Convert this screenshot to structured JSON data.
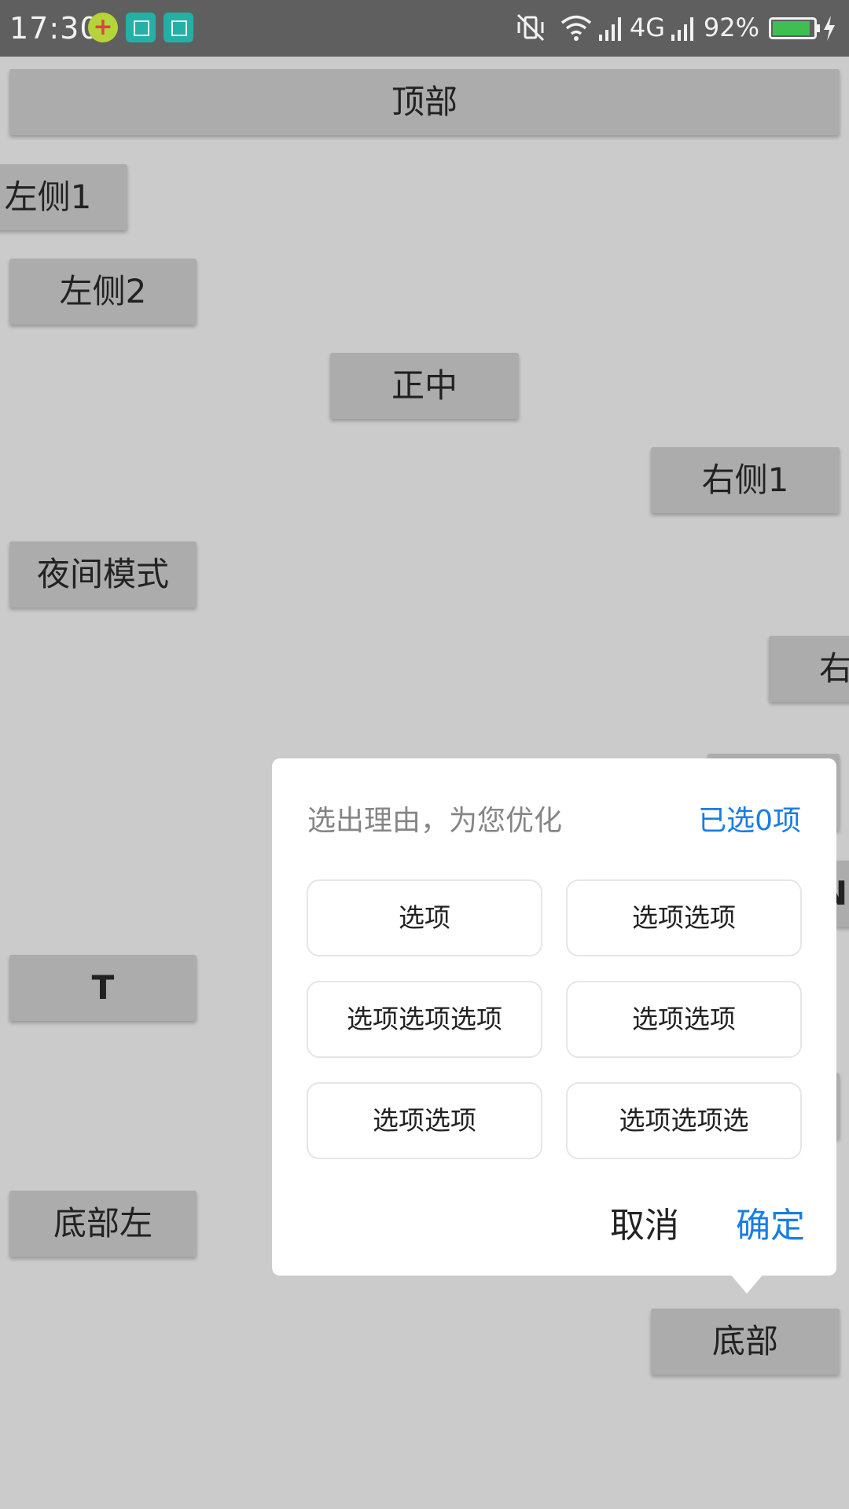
{
  "status_bar": {
    "time": "17:30",
    "network": "4G",
    "battery": "92%",
    "battery_level": 0.92,
    "icons": [
      "app-notification-icon",
      "screenshot-icon",
      "usb-icon",
      "vibrate-off-icon",
      "wifi-icon",
      "signal-icon",
      "signal-icon",
      "battery-icon",
      "charging-icon"
    ]
  },
  "buttons": {
    "top": "顶部",
    "left1": "左侧1",
    "left2": "左侧2",
    "center": "正中",
    "right1": "右侧1",
    "night_mode": "夜间模式",
    "right_partial": "右",
    "n_partial": "N",
    "t": "T",
    "bottom_left": "底部左",
    "bottom": "底部"
  },
  "dialog": {
    "title": "选出理由，为您优化",
    "count": "已选0项",
    "options": [
      "选项",
      "选项选项",
      "选项选项选项",
      "选项选项",
      "选项选项",
      "选项选项选"
    ],
    "cancel": "取消",
    "confirm": "确定"
  },
  "colors": {
    "background": "#cbcbcb",
    "status_bar": "#5f5f5f",
    "button": "#acacac",
    "accent": "#1a7de3",
    "battery": "#3fbf4f"
  }
}
